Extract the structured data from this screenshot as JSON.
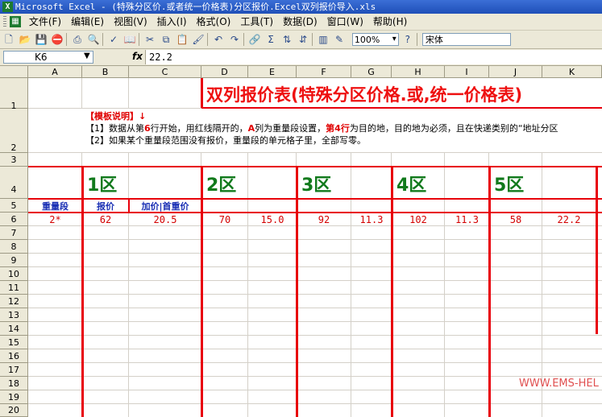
{
  "window": {
    "title": "Microsoft Excel - (特殊分区价.或者统一价格表)分区报价.Excel双列报价导入.xls"
  },
  "menu": [
    "文件(F)",
    "编辑(E)",
    "视图(V)",
    "插入(I)",
    "格式(O)",
    "工具(T)",
    "数据(D)",
    "窗口(W)",
    "帮助(H)"
  ],
  "toolbar": {
    "zoom": "100%",
    "font": "宋体"
  },
  "formula_bar": {
    "name_box": "K6",
    "fx": "fx",
    "formula": "22.2"
  },
  "columns": [
    "A",
    "B",
    "C",
    "D",
    "E",
    "F",
    "G",
    "H",
    "I",
    "J",
    "K"
  ],
  "rows": [
    "1",
    "2",
    "3",
    "4",
    "5",
    "6",
    "7",
    "8",
    "9",
    "10",
    "11",
    "12",
    "13",
    "14",
    "15",
    "16",
    "17",
    "18",
    "19",
    "20"
  ],
  "sheet": {
    "title": "双列报价表(特殊分区价格.或,统一价格表)",
    "notes_heading": "【模板说明】↓",
    "note1_a": "【1】数据从第",
    "note1_b": "6",
    "note1_c": "行开始，用红线隔开的，",
    "note1_d": "A",
    "note1_e": "列为重量段设置，",
    "note1_f": "第4行",
    "note1_g": "为目的地，目的地为必须，且在快递类别的“地址分区",
    "note2": "【2】如果某个重量段范围没有报价，重量段的单元格子里，全部写零。",
    "zones": [
      "1区",
      "2区",
      "3区",
      "4区",
      "5区"
    ],
    "row5": {
      "weight": "重量段",
      "price": "报价",
      "addon": "加价|首重价"
    },
    "row6": [
      "2*",
      "62",
      "20.5",
      "70",
      "15.0",
      "92",
      "11.3",
      "102",
      "11.3",
      "58",
      "22.2"
    ],
    "watermark": "WWW.EMS-HEL"
  }
}
